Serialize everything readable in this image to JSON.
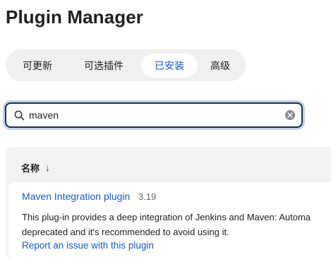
{
  "page": {
    "title": "Plugin Manager"
  },
  "tabs": [
    {
      "label": "可更新",
      "active": false
    },
    {
      "label": "可选插件",
      "active": false
    },
    {
      "label": "已安装",
      "active": true
    },
    {
      "label": "高级",
      "active": false
    }
  ],
  "search": {
    "value": "maven",
    "icon": "search-icon",
    "clear_icon": "clear-icon"
  },
  "table": {
    "column_header": "名称",
    "sort_indicator": "↓",
    "rows": [
      {
        "name": "Maven Integration plugin",
        "version": "3.19",
        "description_line1": "This plug-in provides a deep integration of Jenkins and Maven: Automa",
        "description_line2": "deprecated and it's recommended to avoid using it.",
        "report_link": "Report an issue with this plugin"
      }
    ]
  },
  "colors": {
    "accent": "#1a5bb8",
    "tabs_bg": "#f0f0f0",
    "focus_border": "#1c2e44"
  }
}
